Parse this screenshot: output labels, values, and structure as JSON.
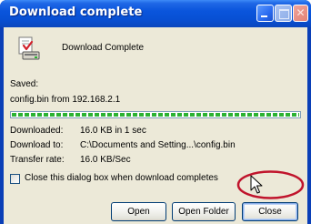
{
  "window": {
    "title": "Download complete"
  },
  "titlebar_buttons": {
    "minimize_icon": "minimize-icon",
    "maximize_icon": "maximize-icon",
    "close_icon": "close-icon",
    "close_glyph": "✕"
  },
  "header": {
    "icon": "download-icon",
    "text": "Download Complete"
  },
  "details": {
    "saved_label": "Saved:",
    "saved_value": "config.bin from 192.168.2.1",
    "progress_fraction": 1.0,
    "progress_color": "#2bb232",
    "downloaded_label": "Downloaded:",
    "downloaded_value": "16.0 KB in 1 sec",
    "download_to_label": "Download to:",
    "download_to_value": "C:\\Documents and Setting...\\config.bin",
    "transfer_rate_label": "Transfer rate:",
    "transfer_rate_value": "16.0 KB/Sec"
  },
  "checkbox": {
    "label": "Close this dialog box when download completes",
    "checked": false
  },
  "buttons": {
    "open": "Open",
    "open_folder": "Open Folder",
    "close": "Close"
  },
  "annotation": {
    "highlight_color": "#c0142c"
  },
  "colors": {
    "titlebar": "#0a55dc",
    "dialog_background": "#ece9d8",
    "button_border": "#003c74"
  }
}
